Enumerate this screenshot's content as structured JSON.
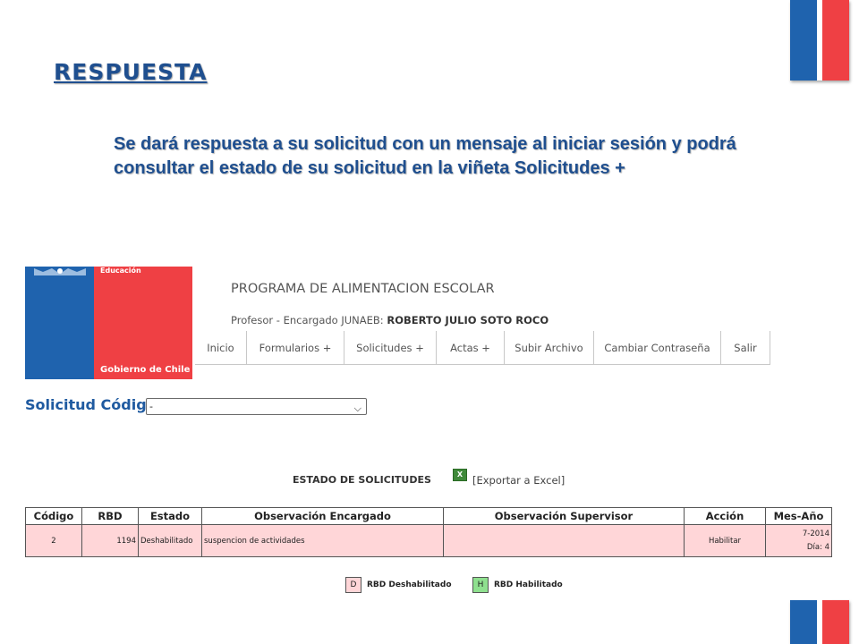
{
  "slide": {
    "title": "RESPUESTA",
    "body": "Se dará respuesta a su solicitud con un mensaje al iniciar sesión y podrá consultar el estado de su solicitud en la viñeta Solicitudes +"
  },
  "app": {
    "header": {
      "ministry_label": "Educación",
      "government_label": "Gobierno de Chile",
      "program_title": "PROGRAMA DE ALIMENTACION ESCOLAR",
      "profile_prefix": "Profesor - Encargado JUNAEB:",
      "profile_name": "ROBERTO JULIO SOTO ROCO"
    },
    "nav": {
      "items": [
        {
          "label": "Inicio"
        },
        {
          "label": "Formularios +"
        },
        {
          "label": "Solicitudes +"
        },
        {
          "label": "Actas +"
        },
        {
          "label": "Subir Archivo"
        },
        {
          "label": "Cambiar Contraseña"
        },
        {
          "label": "Salir"
        }
      ]
    },
    "filter": {
      "label": "Solicitud Código",
      "selected": "-",
      "chevron_icon": "chevron-down-icon"
    },
    "estado": {
      "title": "ESTADO DE SOLICITUDES",
      "export_icon": "excel-icon",
      "export_label": "[Exportar a Excel]"
    },
    "table": {
      "columns": [
        "Código",
        "RBD",
        "Estado",
        "Observación Encargado",
        "Observación Supervisor",
        "Acción",
        "Mes-Año"
      ],
      "rows": [
        {
          "codigo": "2",
          "rbd": "1194",
          "estado": "Deshabilitado",
          "obs_encargado": "suspencion de actividades",
          "obs_supervisor": "",
          "accion": "Habilitar",
          "mes_anio": "7-2014",
          "dia": "Día: 4"
        }
      ]
    },
    "legend": {
      "items": [
        {
          "letter": "D",
          "label": "RBD Deshabilitado",
          "color": "#ffd6d8"
        },
        {
          "letter": "H",
          "label": "RBD Habilitado",
          "color": "#8fe08f"
        }
      ]
    }
  },
  "colors": {
    "flag_blue": "#1f63ae",
    "flag_red": "#ef4044",
    "title_blue": "#1f4f8f",
    "row_pink": "#ffd6d8"
  }
}
